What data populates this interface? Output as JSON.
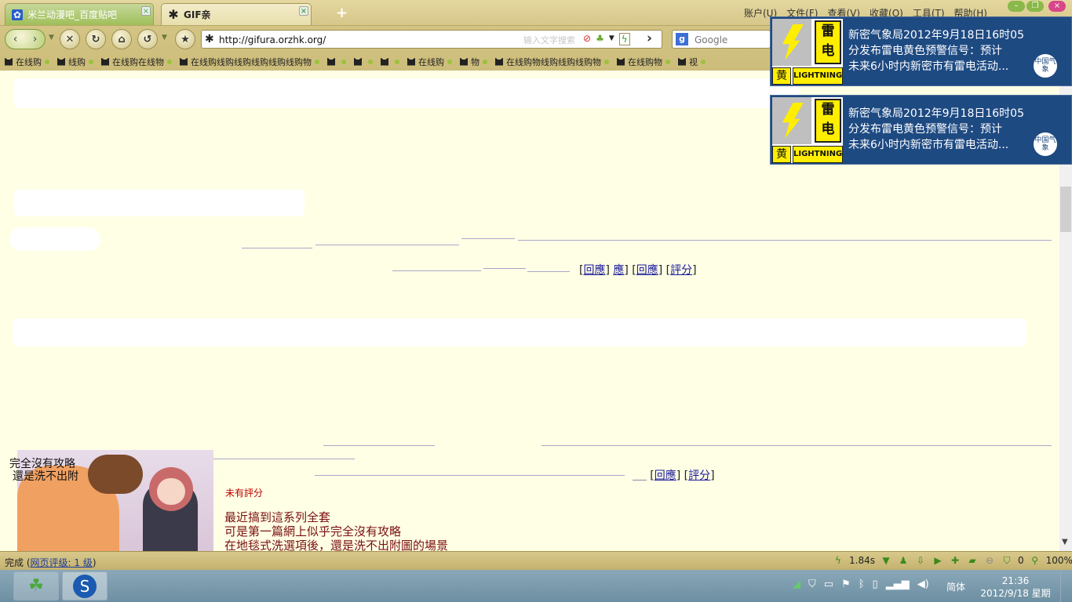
{
  "tabs": [
    {
      "title": "米兰动漫吧_百度贴吧",
      "icon": "paw-icon",
      "active": false
    },
    {
      "title": "GIF亲",
      "icon": "asterisk-icon",
      "active": true
    }
  ],
  "menu": [
    "账户(U)",
    "文件(F)",
    "查看(V)",
    "收藏(O)",
    "工具(T)",
    "帮助(H)"
  ],
  "address": {
    "url": "http://gifura.orzhk.org/",
    "hint": "输入文字搜索"
  },
  "search": {
    "placeholder": "Google"
  },
  "bookmarks": [
    "在线购",
    "线购",
    "在线购在线物",
    "在线购线购线购线购线购线购物",
    "",
    "",
    "",
    "在线购",
    "物",
    "在线购物线购线购线购物",
    "在线购物",
    "视"
  ],
  "content": {
    "post1_links": {
      "reply1": "回應",
      "reply2": "應",
      "reply3": "回應",
      "rate": "評分"
    },
    "post2_links": {
      "reply": "回應",
      "rate": "評分"
    },
    "thumb_caption": [
      "完全沒有攻略",
      "還是洗不出附"
    ],
    "rating": "未有評分",
    "body": [
      "最近搞到這系列全套",
      "可是第一篇網上似乎完全沒有攻略",
      "在地毯式洗選項後，還是洗不出附圖的場景"
    ]
  },
  "status": {
    "text": "完成",
    "rating_link": "网页评级: 1 级",
    "speed": "1.84s",
    "blocked": "0",
    "zoom": "100%"
  },
  "taskbar": {
    "ime": "简体",
    "time": "21:36",
    "date": "2012/9/18 星期二"
  },
  "notifications": [
    {
      "char1": "雷",
      "char2": "电",
      "level": "黄",
      "label": "LIGHTNING",
      "line1": "新密气象局2012年9月18日16时05",
      "line2": "分发布雷电黄色预警信号：预计",
      "line3": "未来6小时内新密市有雷电活动...",
      "seal": "中国气象"
    },
    {
      "char1": "雷",
      "char2": "电",
      "level": "黄",
      "label": "LIGHTNING",
      "line1": "新密气象局2012年9月18日16时05",
      "line2": "分发布雷电黄色预警信号：预计",
      "line3": "未来6小时内新密市有雷电活动...",
      "seal": "中国气象"
    }
  ],
  "colors": {
    "chrome": "#d8c88a",
    "page_bg": "#ffffe6",
    "link": "#1a1a9a",
    "post_text": "#7a1010",
    "notif_bg": "#1e4a82",
    "warning_yellow": "#ffee00"
  }
}
